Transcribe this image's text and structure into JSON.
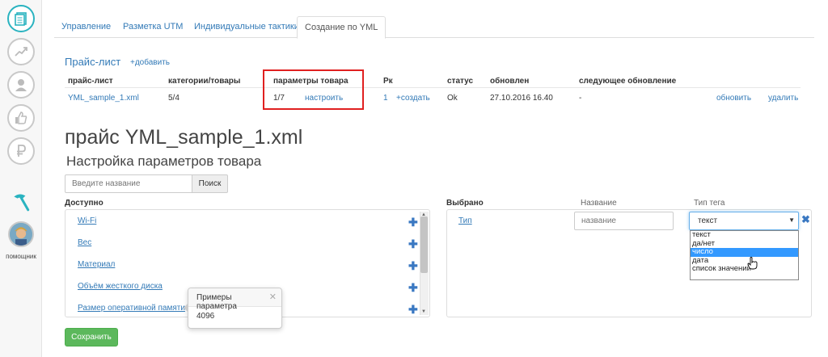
{
  "sidebar": {
    "icons": [
      "documents-icon",
      "growth-chart-icon",
      "user-icon",
      "thumbs-up-icon",
      "ruble-icon",
      "hammer-icon"
    ],
    "assistant_label": "помощник"
  },
  "tabs": [
    {
      "label": "Управление"
    },
    {
      "label": "Разметка UTM"
    },
    {
      "label": "Индивидуальные тактики"
    },
    {
      "label": "Создание по YML"
    }
  ],
  "pricelist": {
    "title": "Прайс-лист",
    "add_link": "+добавить",
    "columns": [
      "прайс-лист",
      "категории/товары",
      "параметры товара",
      "Рк",
      "статус",
      "обновлен",
      "следующее обновление"
    ],
    "row": {
      "name": "YML_sample_1.xml",
      "categories": "5/4",
      "params": "1/7",
      "configure": "настроить",
      "rk_count": "1",
      "create": "+создать",
      "status": "Ok",
      "updated": "27.10.2016 16.40",
      "next_update": "-",
      "refresh": "обновить",
      "delete": "удалить"
    }
  },
  "heading": "прайс YML_sample_1.xml",
  "subheading": "Настройка параметров товара",
  "search": {
    "placeholder": "Введите название",
    "button": "Поиск"
  },
  "available": {
    "label": "Доступно",
    "items": [
      "Wi-Fi",
      "Вес",
      "Материал",
      "Объём жесткого диска",
      "Размер оперативной памяти"
    ]
  },
  "popover": {
    "title": "Примеры параметра",
    "value": "4096"
  },
  "selected": {
    "label": "Выбрано",
    "name_label": "Название",
    "tag_label": "Тип тега",
    "item": "Тип",
    "name_placeholder": "название",
    "tag_value": "текст",
    "options": [
      "текст",
      "да/нет",
      "число",
      "дата",
      "список значений"
    ],
    "highlighted_option": "число"
  },
  "save_button": "Сохранить",
  "colors": {
    "accent": "#337ab7",
    "save": "#5cb85c",
    "highlight_border": "#e02020",
    "dropdown_selection": "#3399ff"
  }
}
